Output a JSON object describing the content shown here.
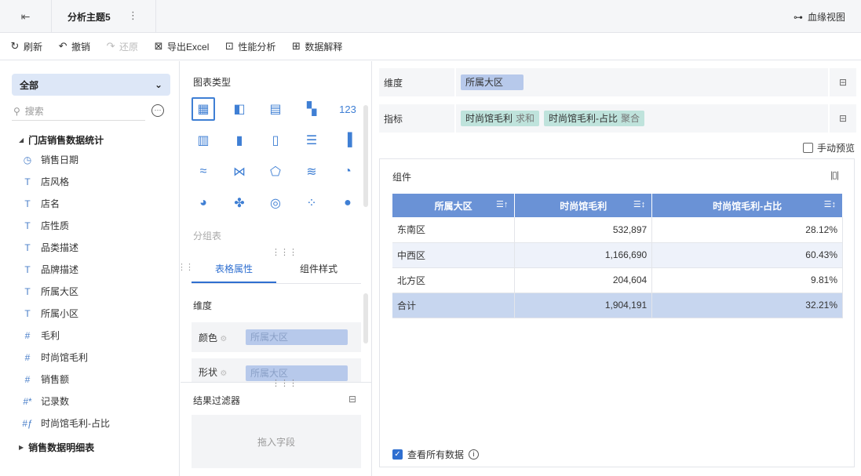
{
  "topbar": {
    "exit_icon": "exit-icon",
    "tab_title": "分析主题5",
    "tab_more": "⋮",
    "lineage_label": "血缘视图"
  },
  "toolbar": {
    "refresh": "刷新",
    "undo": "撤销",
    "redo": "还原",
    "export_excel": "导出Excel",
    "performance": "性能分析",
    "data_explain": "数据解释"
  },
  "left_panel": {
    "package_select": "全部",
    "search_placeholder": "搜索",
    "groups": [
      {
        "label": "门店销售数据统计"
      },
      {
        "label": "销售数据明细表"
      }
    ],
    "fields": [
      {
        "label": "销售日期",
        "type": "date"
      },
      {
        "label": "店风格",
        "type": "text"
      },
      {
        "label": "店名",
        "type": "text"
      },
      {
        "label": "店性质",
        "type": "text"
      },
      {
        "label": "品类描述",
        "type": "text"
      },
      {
        "label": "品牌描述",
        "type": "text"
      },
      {
        "label": "所属大区",
        "type": "text"
      },
      {
        "label": "所属小区",
        "type": "text"
      },
      {
        "label": "毛利",
        "type": "number"
      },
      {
        "label": "时尚馆毛利",
        "type": "number"
      },
      {
        "label": "销售额",
        "type": "number"
      },
      {
        "label": "记录数",
        "type": "count"
      },
      {
        "label": "时尚馆毛利-占比",
        "type": "calc"
      }
    ]
  },
  "middle_panel": {
    "chart_type_title": "图表类型",
    "group_table_label": "分组表",
    "tabs": [
      {
        "label": "表格属性",
        "active": true
      },
      {
        "label": "组件样式",
        "active": false
      }
    ],
    "dimension_label": "维度",
    "props": [
      {
        "label": "颜色",
        "chip": "所属大区"
      },
      {
        "label": "形状",
        "chip": "所属大区"
      }
    ],
    "filter_title": "结果过滤器",
    "drop_hint": "拖入字段"
  },
  "right_panel": {
    "dimension_label": "维度",
    "dimension_chip": "所属大区",
    "measure_label": "指标",
    "measures": [
      {
        "name": "时尚馆毛利",
        "agg": "求和"
      },
      {
        "name": "时尚馆毛利-占比",
        "agg": "聚合"
      }
    ],
    "manual_preview": "手动预览",
    "widget_title": "组件",
    "table": {
      "headers": [
        "所属大区",
        "时尚馆毛利",
        "时尚馆毛利-占比"
      ],
      "rows": [
        [
          "东南区",
          "532,897",
          "28.12%"
        ],
        [
          "中西区",
          "1,166,690",
          "60.43%"
        ],
        [
          "北方区",
          "204,604",
          "9.81%"
        ]
      ],
      "total": [
        "合计",
        "1,904,191",
        "32.21%"
      ]
    },
    "view_all_label": "查看所有数据"
  },
  "colors": {
    "accent": "#2f6fd0",
    "header_blue": "#6a92d6",
    "dim_chip": "#b7c9eb",
    "measure_chip": "#bfe3dc"
  }
}
